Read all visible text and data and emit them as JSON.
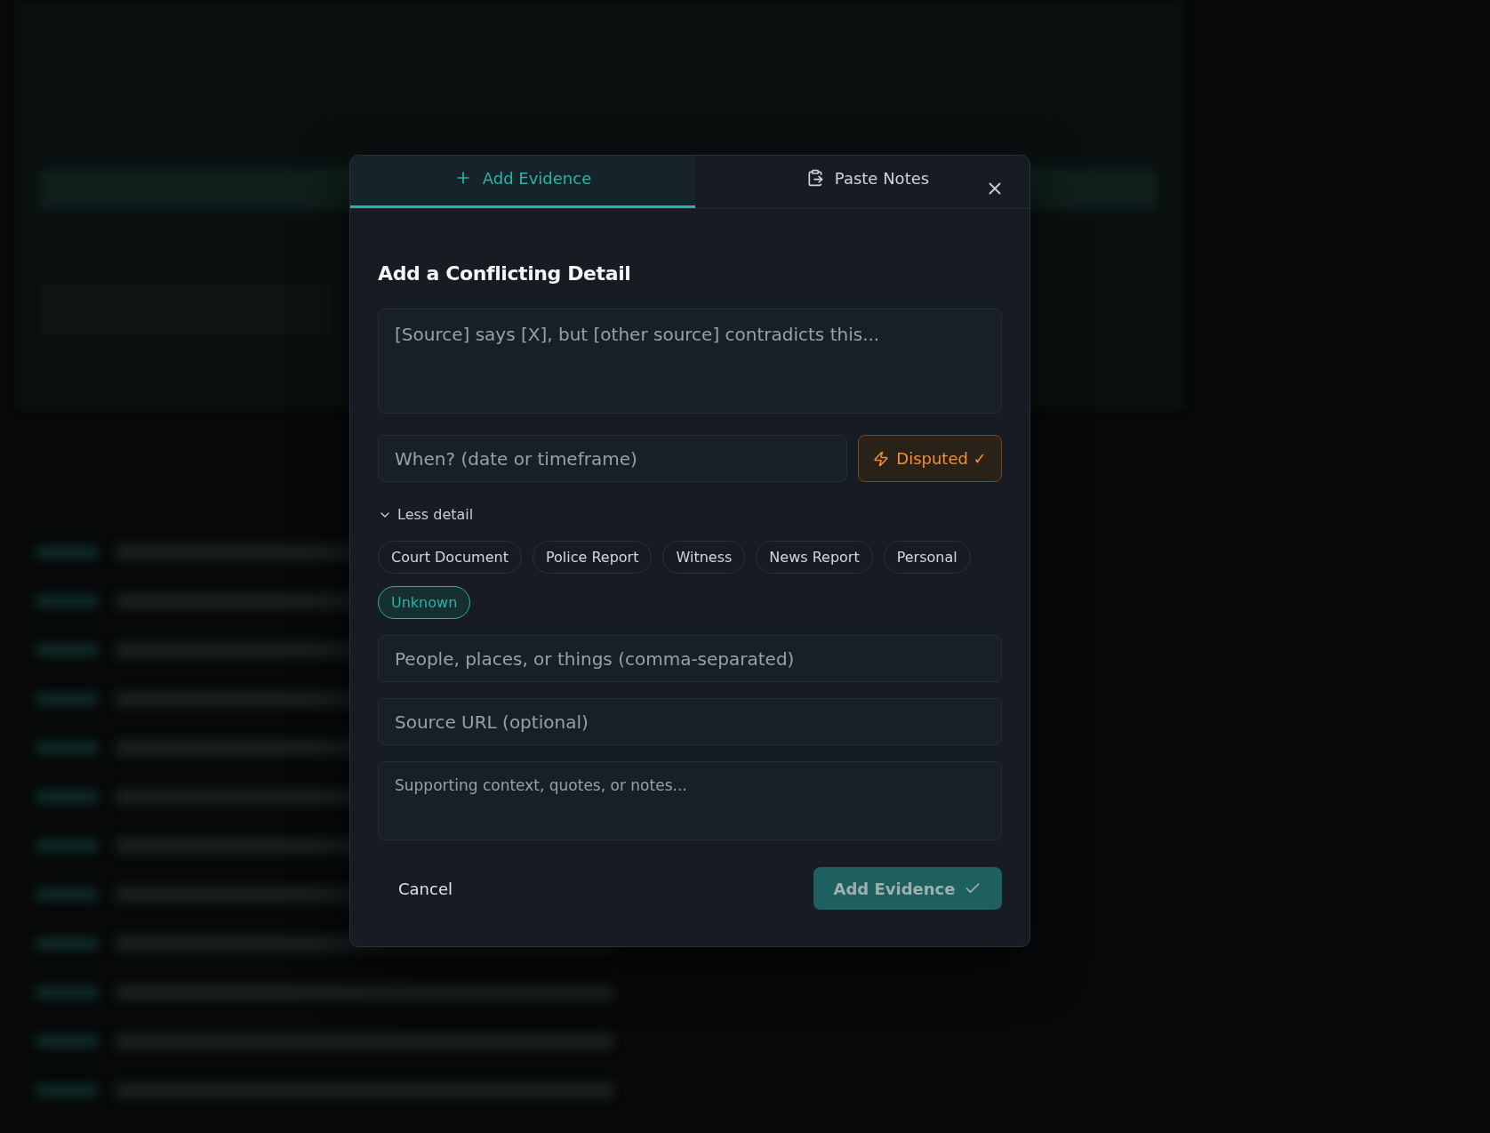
{
  "tabs": [
    {
      "label": "Add Evidence",
      "kind": "add",
      "selected": true
    },
    {
      "label": "Paste Notes",
      "kind": "paste",
      "selected": false
    }
  ],
  "dialog": {
    "title": "Add a Conflicting Detail",
    "claim": {
      "placeholder": "[Source] says [X], but [other source] contradicts this..."
    },
    "when": {
      "placeholder": "When? (date or timeframe)"
    },
    "disputed": {
      "label": "Disputed ✓",
      "on": true
    },
    "detail_toggle": {
      "label": "Less detail",
      "expanded": true
    },
    "source_types": [
      {
        "label": "Court Document",
        "selected": false
      },
      {
        "label": "Police Report",
        "selected": false
      },
      {
        "label": "Witness",
        "selected": false
      },
      {
        "label": "News Report",
        "selected": false
      },
      {
        "label": "Personal",
        "selected": false
      },
      {
        "label": "Unknown",
        "selected": true
      }
    ],
    "entities": {
      "placeholder": "People, places, or things (comma-separated)"
    },
    "source_url": {
      "placeholder": "Source URL (optional)"
    },
    "notes": {
      "placeholder": "Supporting context, quotes, or notes..."
    },
    "cancel": "Cancel",
    "submit": "Add Evidence"
  }
}
